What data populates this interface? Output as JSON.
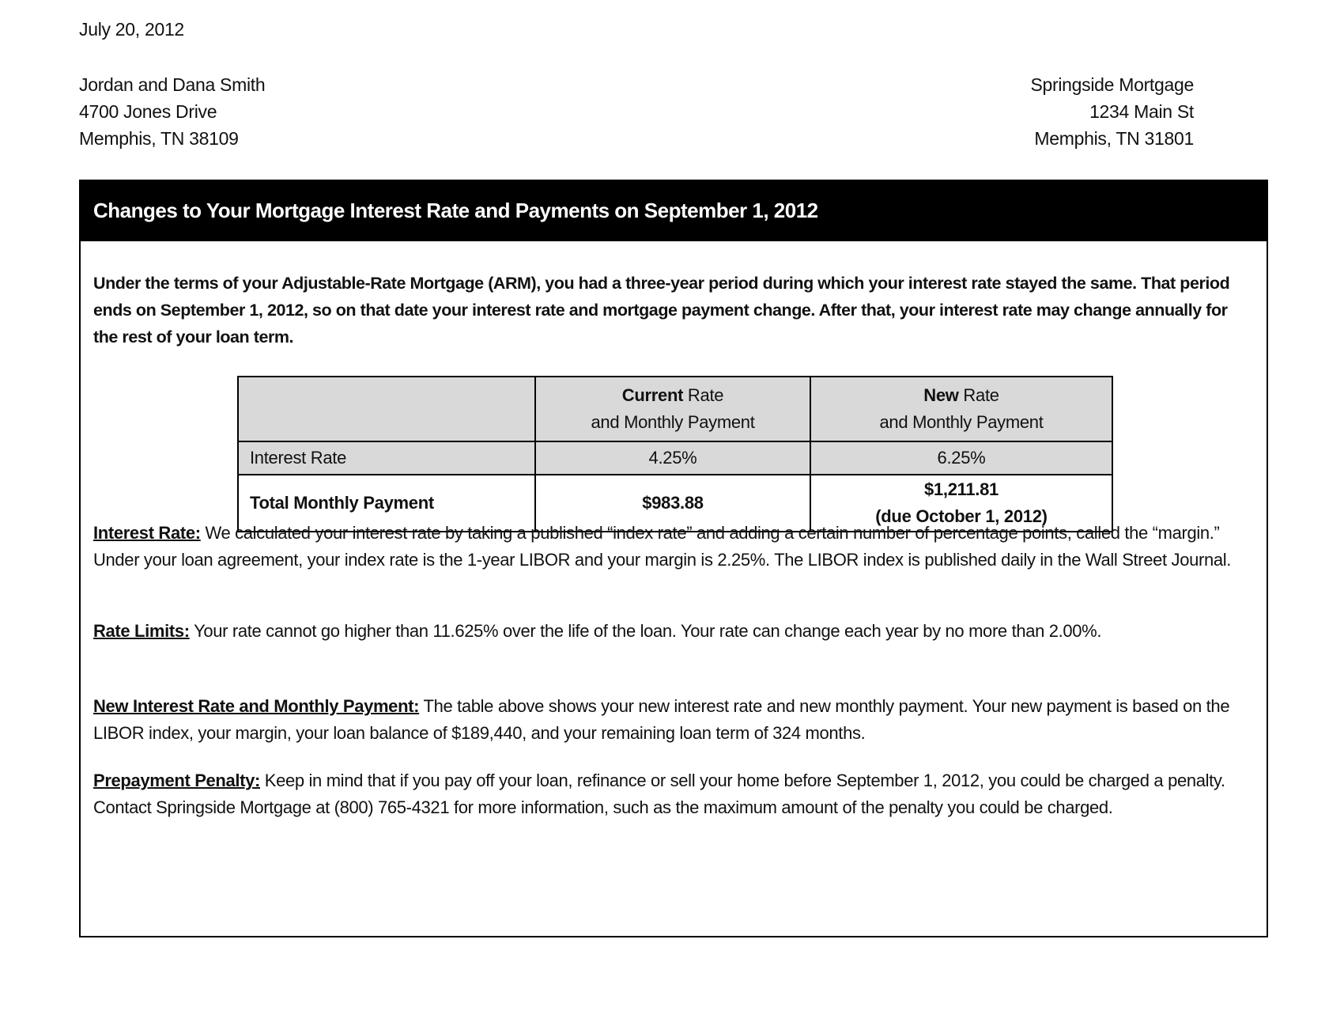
{
  "letter": {
    "date": "July 20, 2012",
    "recipient": {
      "name": "Jordan and Dana Smith",
      "street": "4700 Jones Drive",
      "city_state_zip": "Memphis, TN 38109"
    },
    "sender": {
      "name": "Springside Mortgage",
      "street": "1234 Main St",
      "city_state_zip": "Memphis, TN 31801"
    }
  },
  "notice": {
    "title": "Changes to Your Mortgage Interest Rate and Payments on September 1, 2012",
    "intro": "Under the terms of your Adjustable-Rate Mortgage (ARM), you had a three-year period during which your interest rate stayed the same. That period ends on September 1, 2012, so on that date your interest rate and mortgage payment change.  After that, your interest rate may change annually for the rest of your loan term.",
    "table": {
      "columns": [
        {
          "bold": "Current",
          "rest": " Rate",
          "line2": "and Monthly Payment"
        },
        {
          "bold": "New",
          "rest": " Rate",
          "line2": "and Monthly Payment"
        }
      ],
      "rows": [
        {
          "label": "Interest Rate",
          "current": "4.25%",
          "new": "6.25%",
          "new_note": ""
        },
        {
          "label": "Total Monthly Payment",
          "current": "$983.88",
          "new": "$1,211.81",
          "new_note": "(due October 1, 2012)"
        }
      ]
    },
    "sections": [
      {
        "heading": "Interest Rate:",
        "body": " We calculated your interest rate by taking a published “index rate” and adding a certain number of percentage points, called the “margin.” Under your loan agreement, your index rate is the 1-year LIBOR and your margin is 2.25%. The LIBOR index is published daily in the Wall Street Journal."
      },
      {
        "heading": "Rate Limits:",
        "body": " Your rate cannot go higher than 11.625% over the life of the loan. Your rate can change each year by no more than 2.00%."
      },
      {
        "heading": "New Interest Rate and Monthly Payment:",
        "body": " The table above shows your new interest rate and new monthly payment. Your new payment is based on the LIBOR index, your margin, your loan balance of $189,440, and your remaining loan term of 324 months."
      },
      {
        "heading": "Prepayment Penalty:",
        "body": " Keep in mind that if you pay off your loan, refinance or sell your home before September 1, 2012, you could be charged a penalty.  Contact Springside Mortgage at (800) 765-4321 for more information, such as the maximum amount of the penalty you could be charged."
      }
    ]
  }
}
